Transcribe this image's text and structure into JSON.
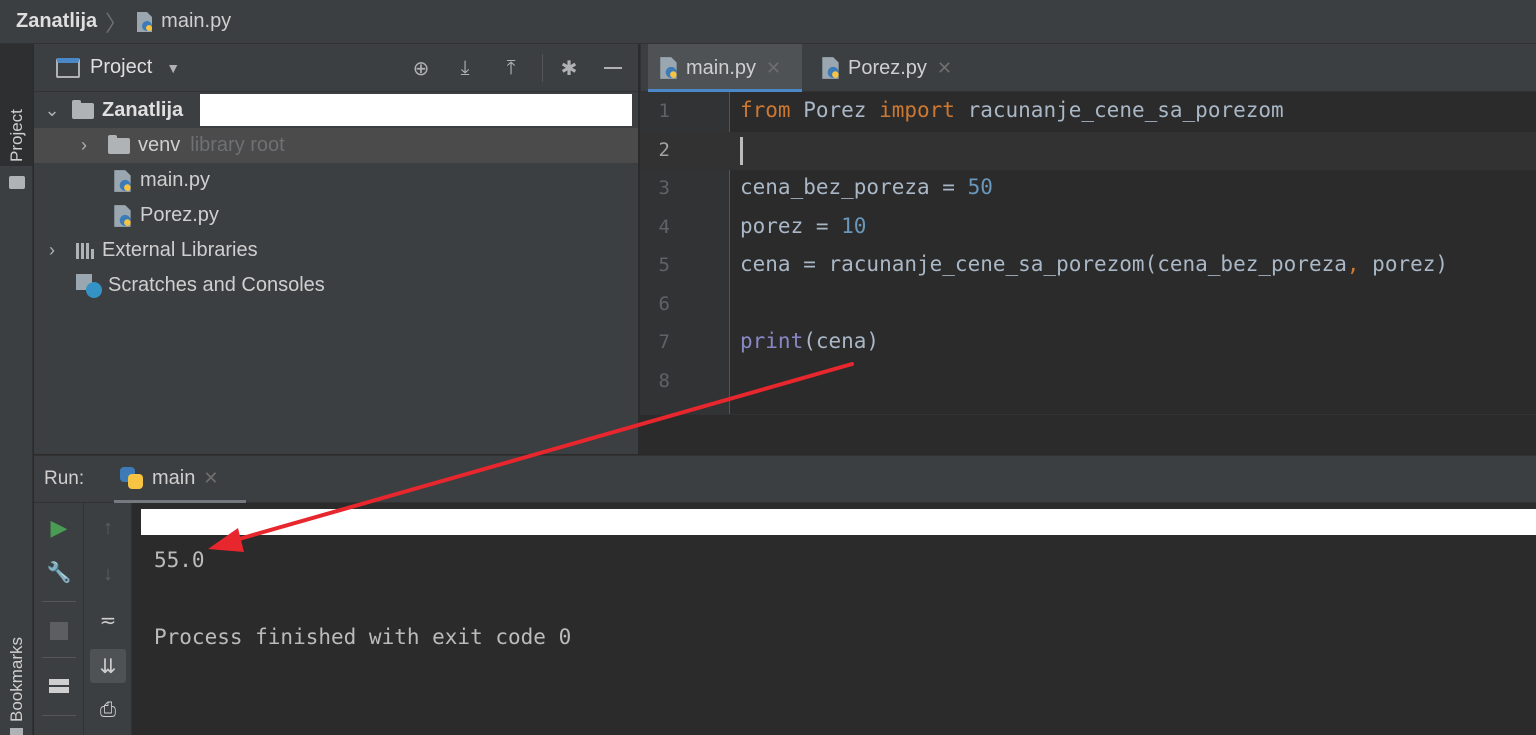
{
  "breadcrumb": {
    "project": "Zanatlija",
    "file": "main.py"
  },
  "left_strip": {
    "project_label": "Project",
    "bookmarks_label": "Bookmarks"
  },
  "project_panel": {
    "title": "Project",
    "tree": {
      "root": "Zanatlija",
      "venv": "venv",
      "venv_note": "library root",
      "file1": "main.py",
      "file2": "Porez.py",
      "ext_libs": "External Libraries",
      "scratches": "Scratches and Consoles"
    }
  },
  "tabs": [
    {
      "label": "main.py",
      "active": true
    },
    {
      "label": "Porez.py",
      "active": false
    }
  ],
  "editor": {
    "line_numbers": [
      "1",
      "2",
      "3",
      "4",
      "5",
      "6",
      "7",
      "8"
    ],
    "code": {
      "l1_kw1": "from",
      "l1_mod": " Porez ",
      "l1_kw2": "import",
      "l1_name": " racunanje_cene_sa_porezom",
      "l3_lhs": "cena_bez_poreza = ",
      "l3_num": "50",
      "l4_lhs": "porez = ",
      "l4_num": "10",
      "l5_a": "cena = racunanje_cene_sa_porezom(cena_bez_poreza",
      "l5_comma": ",",
      "l5_b": " porez)",
      "l7_fn": "print",
      "l7_args": "(cena)"
    }
  },
  "run": {
    "label": "Run:",
    "tab": "main",
    "output": "55.0",
    "exit_message": "Process finished with exit code 0"
  },
  "colors": {
    "annotation_arrow": "#e8262d",
    "keyword": "#cc7832",
    "number": "#6897bb",
    "builtin": "#8888c6",
    "accent": "#4a88c7"
  }
}
